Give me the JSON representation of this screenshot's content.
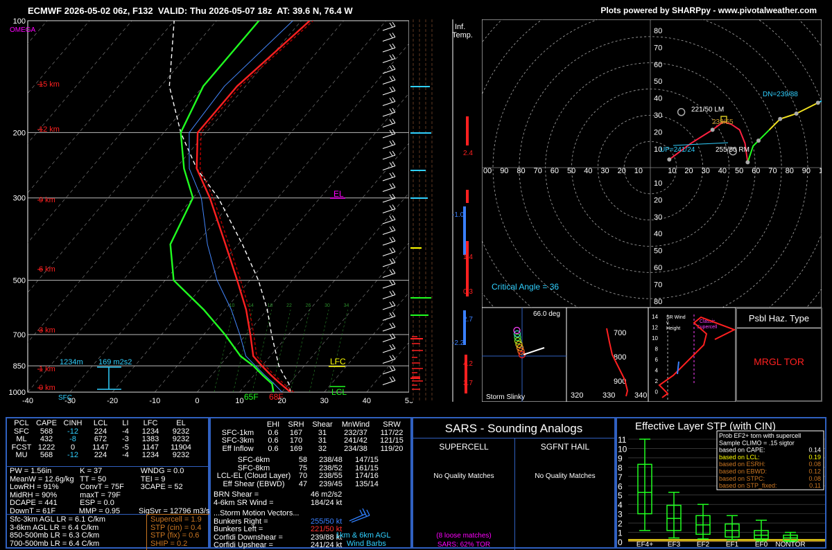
{
  "header": {
    "title": "ECMWF 2026-05-02 06z, F132  VALID: Thu 2026-05-07 18z  AT: 39.6 N, 76.4 W",
    "credit": "Plots powered by SHARPpy - www.pivotalweather.com"
  },
  "colors": {
    "border": "#3060c0",
    "temp": "#ff2020",
    "dewpoint": "#20ff20",
    "virtual": "#ff3030",
    "parcel": "#ffffff",
    "wetbulb": "#4488ff",
    "label_yellow": "#ffff00",
    "label_magenta": "#ff00ff",
    "cyan": "#30d0ff",
    "orange": "#cc7722",
    "grid": "#ffffff"
  },
  "chart_data": [
    {
      "type": "line",
      "name": "skewt",
      "xlim": [
        -40,
        50
      ],
      "ylim": [
        1000,
        100
      ],
      "x_ticks": [
        "-40",
        "-30",
        "-20",
        "-10",
        "0",
        "10",
        "20",
        "30",
        "40",
        "50"
      ],
      "pressure_ticks": [
        "100",
        "200",
        "300",
        "500",
        "700",
        "850",
        "1000"
      ],
      "height_labels": [
        "15 km",
        "12 km",
        "9 km",
        "6 km",
        "3 km",
        "1 km",
        "0 km"
      ],
      "omega_label": "OMEGA",
      "temperature": [
        [
          1000,
          22
        ],
        [
          950,
          18
        ],
        [
          900,
          14
        ],
        [
          850,
          10
        ],
        [
          800,
          6
        ],
        [
          700,
          1
        ],
        [
          600,
          -5
        ],
        [
          500,
          -13
        ],
        [
          400,
          -23
        ],
        [
          300,
          -36
        ],
        [
          250,
          -45
        ],
        [
          200,
          -52
        ],
        [
          150,
          -52
        ],
        [
          100,
          -48
        ]
      ],
      "dewpoint": [
        [
          1000,
          18
        ],
        [
          950,
          16
        ],
        [
          900,
          12
        ],
        [
          850,
          8
        ],
        [
          800,
          3
        ],
        [
          700,
          -5
        ],
        [
          600,
          -15
        ],
        [
          500,
          -28
        ],
        [
          400,
          -36
        ],
        [
          300,
          -40
        ],
        [
          250,
          -48
        ],
        [
          200,
          -56
        ],
        [
          150,
          -60
        ],
        [
          100,
          -60
        ]
      ],
      "parcel": [
        [
          1000,
          22
        ],
        [
          950,
          20
        ],
        [
          900,
          17
        ],
        [
          850,
          14
        ],
        [
          700,
          6
        ],
        [
          600,
          0
        ],
        [
          500,
          -8
        ],
        [
          400,
          -19
        ],
        [
          300,
          -34
        ],
        [
          250,
          -45
        ],
        [
          200,
          -56
        ],
        [
          150,
          -68
        ],
        [
          100,
          -80
        ]
      ],
      "surface_labels": {
        "temp": "68F",
        "dew": "65F",
        "sfc": "SFC",
        "lfc": "LFC",
        "lcl": "LCL",
        "el": "EL"
      },
      "inflow": {
        "depth": "1234m",
        "srh": "169 m2s2"
      },
      "mixing_ratio_labels": [
        "10",
        "14",
        "18",
        "22",
        "26",
        "30",
        "34"
      ]
    },
    {
      "type": "line",
      "name": "hodograph",
      "rings": [
        "10",
        "20",
        "30",
        "40",
        "50",
        "60",
        "70",
        "80"
      ],
      "x_labels": [
        "00",
        "90",
        "80",
        "70",
        "60",
        "50",
        "40",
        "30",
        "20",
        "10",
        "",
        "10",
        "20",
        "30",
        "40",
        "50",
        "60",
        "70",
        "80",
        "90",
        "1"
      ],
      "y_labels_top": [
        "80",
        "70",
        "60",
        "50",
        "40",
        "30",
        "20",
        "10"
      ],
      "y_labels_bottom": [
        "10",
        "20",
        "30",
        "40",
        "50",
        "60",
        "70",
        "80"
      ],
      "labels": {
        "lm": "221/50 LM",
        "rm": "255/50 RM",
        "up": "UP=241/24",
        "dn": "DN=239/88",
        "mean": "238/55"
      },
      "critical_angle": "Critical Angle = 36"
    },
    {
      "type": "line",
      "name": "temp-advection",
      "labels": [
        "2.4",
        "-1.0",
        "1.4",
        "0.3",
        "2.7",
        "-2.2",
        "4.2",
        "3.7"
      ],
      "title": "Inf. Temp."
    },
    {
      "type": "line",
      "name": "storm-slinky",
      "angle": "66.0 deg",
      "title": "Storm Slinky"
    },
    {
      "type": "line",
      "name": "theta-e",
      "y_labels": [
        "700",
        "800",
        "900"
      ],
      "x_labels": [
        "320",
        "330",
        "340"
      ]
    },
    {
      "type": "line",
      "name": "sr-wind",
      "y_labels": [
        "14",
        "12",
        "10",
        "8",
        "6",
        "4",
        "2",
        "0"
      ],
      "labels": [
        "SR Wind v. Height",
        "Classic Supercell"
      ]
    },
    {
      "type": "bar",
      "name": "stp",
      "title": "Effective Layer STP (with CIN)",
      "categories": [
        "EF4+",
        "EF3",
        "EF2",
        "EF1",
        "EF0",
        "NONTOR"
      ],
      "y_ticks": [
        "11",
        "10",
        "9",
        "8",
        "7",
        "6",
        "5",
        "4",
        "3",
        "2",
        "1",
        "0"
      ],
      "ylim": [
        0,
        11
      ],
      "box_values": [
        [
          1.2,
          3,
          5.3,
          8.3,
          11
        ],
        [
          0.4,
          1.2,
          2.5,
          3.9,
          5.3
        ],
        [
          0.3,
          0.8,
          1.8,
          2.8,
          4
        ],
        [
          0.2,
          0.5,
          1.2,
          1.9,
          2.8
        ],
        [
          0.1,
          0.3,
          0.7,
          1.2,
          2.3
        ],
        [
          0,
          0.1,
          0.4,
          0.7,
          1
        ]
      ],
      "value_line": 0.19
    }
  ],
  "parcel_table": {
    "headers": [
      "PCL",
      "CAPE",
      "CINH",
      "LCL",
      "LI",
      "LFC",
      "EL"
    ],
    "rows": [
      [
        "SFC",
        "568",
        "-12",
        "224",
        "-4",
        "1234",
        "9232"
      ],
      [
        "ML",
        "432",
        "-8",
        "672",
        "-3",
        "1383",
        "9232"
      ],
      [
        "FCST",
        "1222",
        "0",
        "1147",
        "-5",
        "1147",
        "11904"
      ],
      [
        "MU",
        "568",
        "-12",
        "224",
        "-4",
        "1234",
        "9232"
      ]
    ]
  },
  "indices": [
    [
      "PW = 1.56in",
      "K = 37",
      "WNDG = 0.0"
    ],
    [
      "MeanW = 12.6g/kg",
      "TT = 50",
      "TEI = 9"
    ],
    [
      "LowRH = 91%",
      "ConvT = 75F",
      "3CAPE = 52"
    ],
    [
      "MidRH = 90%",
      "maxT = 79F",
      ""
    ],
    [
      "DCAPE = 441",
      "ESP = 0.0",
      ""
    ],
    [
      "DownT = 61F",
      "MMP = 0.95",
      "SigSvr = 12796 m3/s3"
    ]
  ],
  "lapse_rates": [
    "Sfc-3km AGL LR = 6.1 C/km",
    "3-6km AGL LR = 6.4 C/km",
    "850-500mb LR = 6.3 C/km",
    "700-500mb LR = 6.4 C/km"
  ],
  "composite": [
    "Supercell = 1.9",
    "STP (cin) = 0.4",
    "STP (fix) = 0.6",
    "SHIP = 0.2"
  ],
  "kinematics": {
    "headers": [
      "",
      "EHI",
      "SRH",
      "Shear",
      "MnWind",
      "SRW"
    ],
    "rows": [
      [
        "SFC-1km",
        "0.6",
        "167",
        "31",
        "232/37",
        "117/22"
      ],
      [
        "SFC-3km",
        "0.6",
        "170",
        "31",
        "241/42",
        "121/15"
      ],
      [
        "Eff Inflow",
        "0.6",
        "169",
        "32",
        "234/38",
        "119/20"
      ],
      [
        "SFC-6km",
        "",
        "",
        "58",
        "238/48",
        "147/15"
      ],
      [
        "SFC-8km",
        "",
        "",
        "75",
        "238/52",
        "161/15"
      ],
      [
        "LCL-EL (Cloud Layer)",
        "",
        "",
        "70",
        "238/55",
        "174/16"
      ],
      [
        "Eff Shear (EBWD)",
        "",
        "",
        "47",
        "239/45",
        "135/14"
      ]
    ],
    "brn_shear": [
      "BRN Shear =",
      "46 m2/s2"
    ],
    "sr_wind": [
      "4-6km SR Wind =",
      "184/24 kt"
    ],
    "vectors_title": "...Storm Motion Vectors...",
    "vectors": [
      [
        "Bunkers Right =",
        "255/50 kt"
      ],
      [
        "Bunkers Left =",
        "221/50 kt"
      ],
      [
        "Corfidi Downshear =",
        "239/88 kt"
      ],
      [
        "Corfidi Upshear =",
        "241/24 kt"
      ]
    ],
    "barbs_label": [
      "1km & 6km AGL",
      "Wind Barbs"
    ]
  },
  "sars": {
    "title": "SARS - Sounding Analogs",
    "supercell": "SUPERCELL",
    "hail": "SGFNT HAIL",
    "no_match_1": "No Quality Matches",
    "no_match_2": "No Quality Matches",
    "loose": "(8 loose matches)",
    "tor": "SARS: 62% TOR"
  },
  "stp_box": {
    "lines": [
      [
        "Prob EF2+ torn with supercell",
        ""
      ],
      [
        "Sample CLIMO = .15 sigtor",
        ""
      ],
      [
        "based on CAPE:",
        "0.14"
      ],
      [
        "based on LCL:",
        "0.19"
      ],
      [
        "based on ESRH:",
        "0.08"
      ],
      [
        "based on EBWD:",
        "0.12"
      ],
      [
        "based on STPC:",
        "0.08"
      ],
      [
        "based on STP_fixed:",
        "0.11"
      ]
    ]
  },
  "hazard": {
    "title": "Psbl Haz. Type",
    "value": "MRGL TOR"
  }
}
